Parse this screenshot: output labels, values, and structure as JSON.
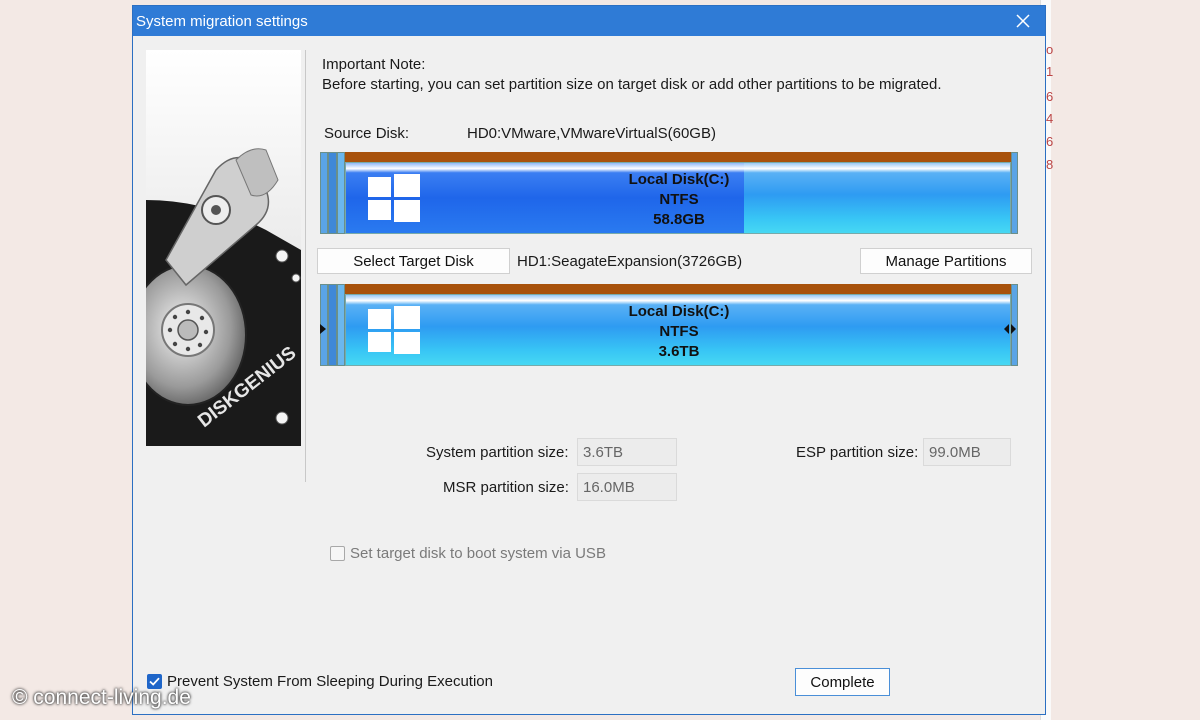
{
  "dialog": {
    "title": "System migration settings",
    "close_icon": "close-icon"
  },
  "note": {
    "heading": "Important Note:",
    "body": "Before starting, you can set partition size on target disk or add other partitions to be migrated."
  },
  "source": {
    "label": "Source Disk:",
    "disk": "HD0:VMware,VMwareVirtualS(60GB)",
    "partition": {
      "name": "Local Disk(C:)",
      "fs": "NTFS",
      "size": "58.8GB",
      "used_fraction": 0.6
    }
  },
  "target": {
    "select_button": "Select Target Disk",
    "disk": "HD1:SeagateExpansion(3726GB)",
    "manage_button": "Manage Partitions",
    "partition": {
      "name": "Local Disk(C:)",
      "fs": "NTFS",
      "size": "3.6TB"
    }
  },
  "sizes": {
    "system_label": "System partition size:",
    "system_value": "3.6TB",
    "esp_label": "ESP partition size:",
    "esp_value": "99.0MB",
    "msr_label": "MSR partition size:",
    "msr_value": "16.0MB"
  },
  "options": {
    "usb_boot_label": "Set target disk to boot system via USB",
    "usb_boot_checked": false,
    "prevent_sleep_label": "Prevent System From Sleeping During Execution",
    "prevent_sleep_checked": true
  },
  "complete_button": "Complete",
  "branding": {
    "logo_text": "DISKGENIUS"
  },
  "watermark": "© connect-living.de",
  "background_glyphs": [
    "o",
    "1",
    "6",
    "4",
    "6",
    "8"
  ],
  "colors": {
    "titlebar": "#2f7bd6",
    "accent": "#1f66ea",
    "partition_top": "#a8520c"
  }
}
